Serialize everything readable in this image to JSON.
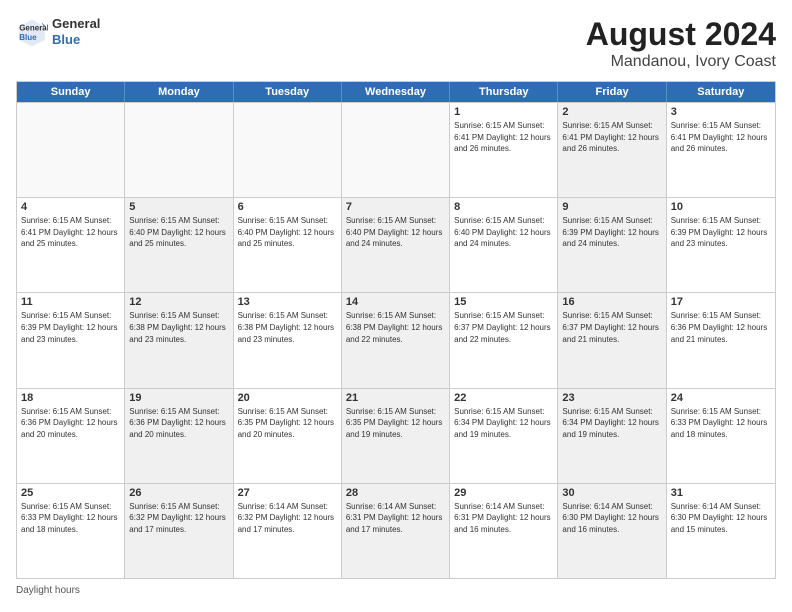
{
  "header": {
    "logo_line1": "General",
    "logo_line2": "Blue",
    "title": "August 2024",
    "subtitle": "Mandanou, Ivory Coast"
  },
  "days_of_week": [
    "Sunday",
    "Monday",
    "Tuesday",
    "Wednesday",
    "Thursday",
    "Friday",
    "Saturday"
  ],
  "weeks": [
    [
      {
        "num": "",
        "info": "",
        "empty": true
      },
      {
        "num": "",
        "info": "",
        "empty": true
      },
      {
        "num": "",
        "info": "",
        "empty": true
      },
      {
        "num": "",
        "info": "",
        "empty": true
      },
      {
        "num": "1",
        "info": "Sunrise: 6:15 AM\nSunset: 6:41 PM\nDaylight: 12 hours\nand 26 minutes.",
        "empty": false
      },
      {
        "num": "2",
        "info": "Sunrise: 6:15 AM\nSunset: 6:41 PM\nDaylight: 12 hours\nand 26 minutes.",
        "empty": false,
        "shaded": true
      },
      {
        "num": "3",
        "info": "Sunrise: 6:15 AM\nSunset: 6:41 PM\nDaylight: 12 hours\nand 26 minutes.",
        "empty": false
      }
    ],
    [
      {
        "num": "4",
        "info": "Sunrise: 6:15 AM\nSunset: 6:41 PM\nDaylight: 12 hours\nand 25 minutes.",
        "empty": false
      },
      {
        "num": "5",
        "info": "Sunrise: 6:15 AM\nSunset: 6:40 PM\nDaylight: 12 hours\nand 25 minutes.",
        "empty": false,
        "shaded": true
      },
      {
        "num": "6",
        "info": "Sunrise: 6:15 AM\nSunset: 6:40 PM\nDaylight: 12 hours\nand 25 minutes.",
        "empty": false
      },
      {
        "num": "7",
        "info": "Sunrise: 6:15 AM\nSunset: 6:40 PM\nDaylight: 12 hours\nand 24 minutes.",
        "empty": false,
        "shaded": true
      },
      {
        "num": "8",
        "info": "Sunrise: 6:15 AM\nSunset: 6:40 PM\nDaylight: 12 hours\nand 24 minutes.",
        "empty": false
      },
      {
        "num": "9",
        "info": "Sunrise: 6:15 AM\nSunset: 6:39 PM\nDaylight: 12 hours\nand 24 minutes.",
        "empty": false,
        "shaded": true
      },
      {
        "num": "10",
        "info": "Sunrise: 6:15 AM\nSunset: 6:39 PM\nDaylight: 12 hours\nand 23 minutes.",
        "empty": false
      }
    ],
    [
      {
        "num": "11",
        "info": "Sunrise: 6:15 AM\nSunset: 6:39 PM\nDaylight: 12 hours\nand 23 minutes.",
        "empty": false
      },
      {
        "num": "12",
        "info": "Sunrise: 6:15 AM\nSunset: 6:38 PM\nDaylight: 12 hours\nand 23 minutes.",
        "empty": false,
        "shaded": true
      },
      {
        "num": "13",
        "info": "Sunrise: 6:15 AM\nSunset: 6:38 PM\nDaylight: 12 hours\nand 23 minutes.",
        "empty": false
      },
      {
        "num": "14",
        "info": "Sunrise: 6:15 AM\nSunset: 6:38 PM\nDaylight: 12 hours\nand 22 minutes.",
        "empty": false,
        "shaded": true
      },
      {
        "num": "15",
        "info": "Sunrise: 6:15 AM\nSunset: 6:37 PM\nDaylight: 12 hours\nand 22 minutes.",
        "empty": false
      },
      {
        "num": "16",
        "info": "Sunrise: 6:15 AM\nSunset: 6:37 PM\nDaylight: 12 hours\nand 21 minutes.",
        "empty": false,
        "shaded": true
      },
      {
        "num": "17",
        "info": "Sunrise: 6:15 AM\nSunset: 6:36 PM\nDaylight: 12 hours\nand 21 minutes.",
        "empty": false
      }
    ],
    [
      {
        "num": "18",
        "info": "Sunrise: 6:15 AM\nSunset: 6:36 PM\nDaylight: 12 hours\nand 20 minutes.",
        "empty": false
      },
      {
        "num": "19",
        "info": "Sunrise: 6:15 AM\nSunset: 6:36 PM\nDaylight: 12 hours\nand 20 minutes.",
        "empty": false,
        "shaded": true
      },
      {
        "num": "20",
        "info": "Sunrise: 6:15 AM\nSunset: 6:35 PM\nDaylight: 12 hours\nand 20 minutes.",
        "empty": false
      },
      {
        "num": "21",
        "info": "Sunrise: 6:15 AM\nSunset: 6:35 PM\nDaylight: 12 hours\nand 19 minutes.",
        "empty": false,
        "shaded": true
      },
      {
        "num": "22",
        "info": "Sunrise: 6:15 AM\nSunset: 6:34 PM\nDaylight: 12 hours\nand 19 minutes.",
        "empty": false
      },
      {
        "num": "23",
        "info": "Sunrise: 6:15 AM\nSunset: 6:34 PM\nDaylight: 12 hours\nand 19 minutes.",
        "empty": false,
        "shaded": true
      },
      {
        "num": "24",
        "info": "Sunrise: 6:15 AM\nSunset: 6:33 PM\nDaylight: 12 hours\nand 18 minutes.",
        "empty": false
      }
    ],
    [
      {
        "num": "25",
        "info": "Sunrise: 6:15 AM\nSunset: 6:33 PM\nDaylight: 12 hours\nand 18 minutes.",
        "empty": false
      },
      {
        "num": "26",
        "info": "Sunrise: 6:15 AM\nSunset: 6:32 PM\nDaylight: 12 hours\nand 17 minutes.",
        "empty": false,
        "shaded": true
      },
      {
        "num": "27",
        "info": "Sunrise: 6:14 AM\nSunset: 6:32 PM\nDaylight: 12 hours\nand 17 minutes.",
        "empty": false
      },
      {
        "num": "28",
        "info": "Sunrise: 6:14 AM\nSunset: 6:31 PM\nDaylight: 12 hours\nand 17 minutes.",
        "empty": false,
        "shaded": true
      },
      {
        "num": "29",
        "info": "Sunrise: 6:14 AM\nSunset: 6:31 PM\nDaylight: 12 hours\nand 16 minutes.",
        "empty": false
      },
      {
        "num": "30",
        "info": "Sunrise: 6:14 AM\nSunset: 6:30 PM\nDaylight: 12 hours\nand 16 minutes.",
        "empty": false,
        "shaded": true
      },
      {
        "num": "31",
        "info": "Sunrise: 6:14 AM\nSunset: 6:30 PM\nDaylight: 12 hours\nand 15 minutes.",
        "empty": false
      }
    ]
  ],
  "footer": {
    "note": "Daylight hours"
  }
}
